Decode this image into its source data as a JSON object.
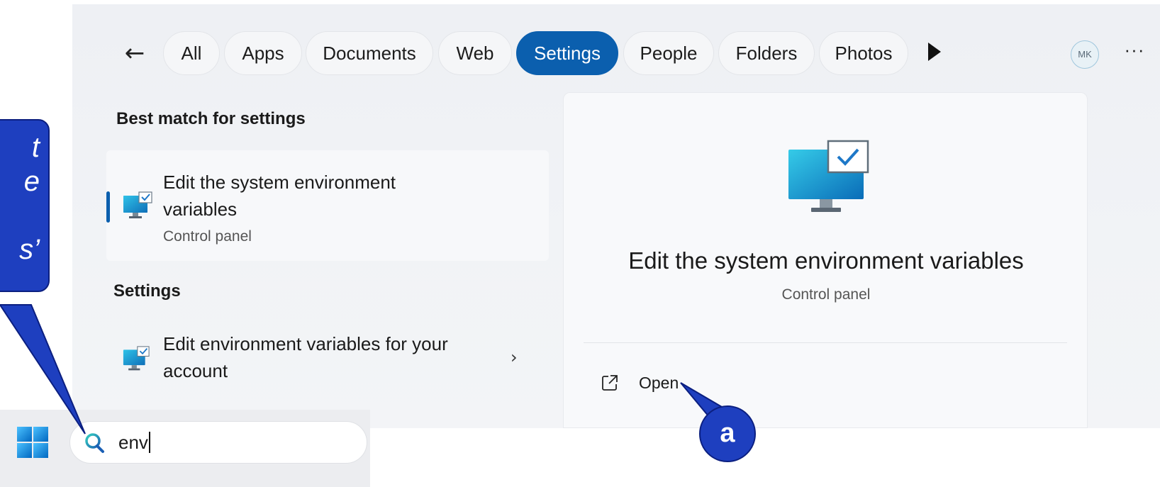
{
  "filter_bar": {
    "back_label": "←",
    "tabs": [
      {
        "label": "All",
        "active": false
      },
      {
        "label": "Apps",
        "active": false
      },
      {
        "label": "Documents",
        "active": false
      },
      {
        "label": "Web",
        "active": false
      },
      {
        "label": "Settings",
        "active": true
      },
      {
        "label": "People",
        "active": false
      },
      {
        "label": "Folders",
        "active": false
      },
      {
        "label": "Photos",
        "active": false
      }
    ],
    "avatar_initials": "MK",
    "more_label": "···"
  },
  "results": {
    "best_match_heading": "Best match for settings",
    "best_match": {
      "title_line1": "Edit the system environment",
      "title_line2": "variables",
      "subtitle": "Control panel"
    },
    "settings_heading": "Settings",
    "settings_item": {
      "title_line1": "Edit environment variables for your",
      "title_line2": "account",
      "chevron": "›"
    }
  },
  "preview": {
    "title": "Edit the system environment variables",
    "subtitle": "Control panel",
    "action_open": "Open"
  },
  "taskbar": {
    "search_value": "env"
  },
  "annotations": {
    "callout_lines": [
      "t",
      "e",
      "",
      "s’"
    ],
    "badge_label": "a"
  },
  "colors": {
    "accent": "#0b5fae",
    "annotation_blue": "#1e3fbf"
  }
}
